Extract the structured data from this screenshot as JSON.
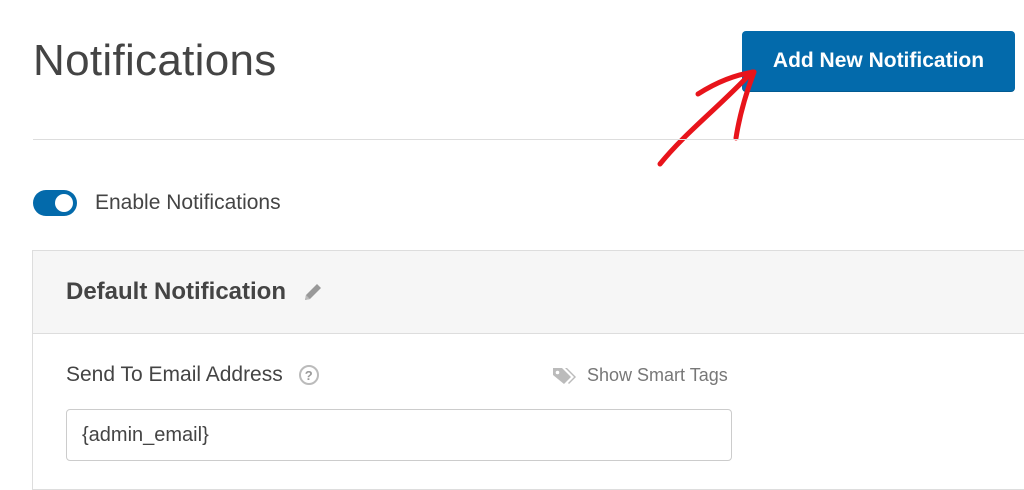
{
  "page": {
    "title": "Notifications"
  },
  "header": {
    "add_button_label": "Add New Notification"
  },
  "toggle": {
    "label": "Enable Notifications",
    "enabled": true
  },
  "notification": {
    "title": "Default Notification",
    "email_field": {
      "label": "Send To Email Address",
      "value": "{admin_email}"
    },
    "smart_tags_label": "Show Smart Tags"
  },
  "colors": {
    "accent": "#036aab",
    "annotation": "#e8141b"
  },
  "icons": [
    "pencil-icon",
    "help-icon",
    "tag-icon",
    "annotation-arrow"
  ]
}
